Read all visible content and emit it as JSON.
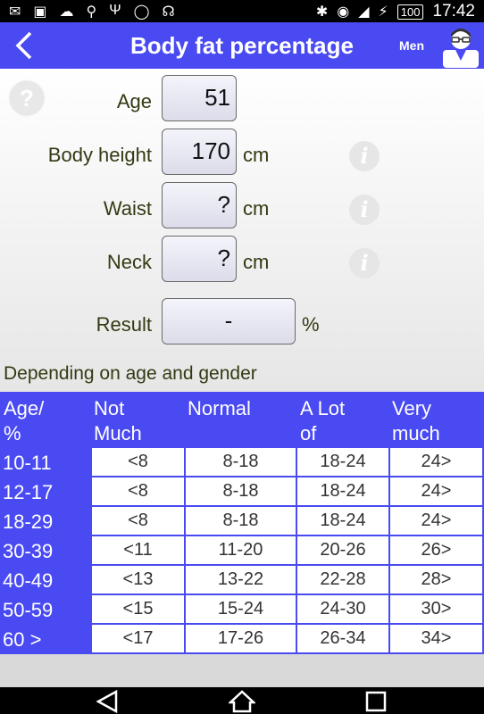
{
  "status": {
    "time": "17:42",
    "battery": "100"
  },
  "appbar": {
    "title": "Body fat percentage",
    "gender": "Men"
  },
  "help": {
    "label": "?"
  },
  "info": {
    "label": "i"
  },
  "form": {
    "age": {
      "label": "Age",
      "value": "51"
    },
    "height": {
      "label": "Body height",
      "value": "170",
      "unit": "cm"
    },
    "waist": {
      "label": "Waist",
      "value": "?",
      "unit": "cm"
    },
    "neck": {
      "label": "Neck",
      "value": "?",
      "unit": "cm"
    },
    "result": {
      "label": "Result",
      "value": "-",
      "unit": "%"
    }
  },
  "subtitle": "Depending on age and gender",
  "table": {
    "headers": [
      [
        "Age/",
        "%"
      ],
      [
        "Not",
        "Much"
      ],
      [
        "Normal",
        ""
      ],
      [
        "A Lot",
        "of"
      ],
      [
        "Very",
        "much"
      ]
    ],
    "rows": [
      {
        "age": "10-11",
        "cells": [
          "<8",
          "8-18",
          "18-24",
          "24>"
        ]
      },
      {
        "age": "12-17",
        "cells": [
          "<8",
          "8-18",
          "18-24",
          "24>"
        ]
      },
      {
        "age": "18-29",
        "cells": [
          "<8",
          "8-18",
          "18-24",
          "24>"
        ]
      },
      {
        "age": "30-39",
        "cells": [
          "<11",
          "11-20",
          "20-26",
          "26>"
        ]
      },
      {
        "age": "40-49",
        "cells": [
          "<13",
          "13-22",
          "22-28",
          "28>"
        ]
      },
      {
        "age": "50-59",
        "cells": [
          "<15",
          "15-24",
          "24-30",
          "30>"
        ]
      },
      {
        "age": "60 >",
        "cells": [
          "<17",
          "17-26",
          "26-34",
          "34>"
        ]
      }
    ]
  },
  "colors": {
    "accent": "#4a4af2",
    "label_text": "#333a12"
  }
}
